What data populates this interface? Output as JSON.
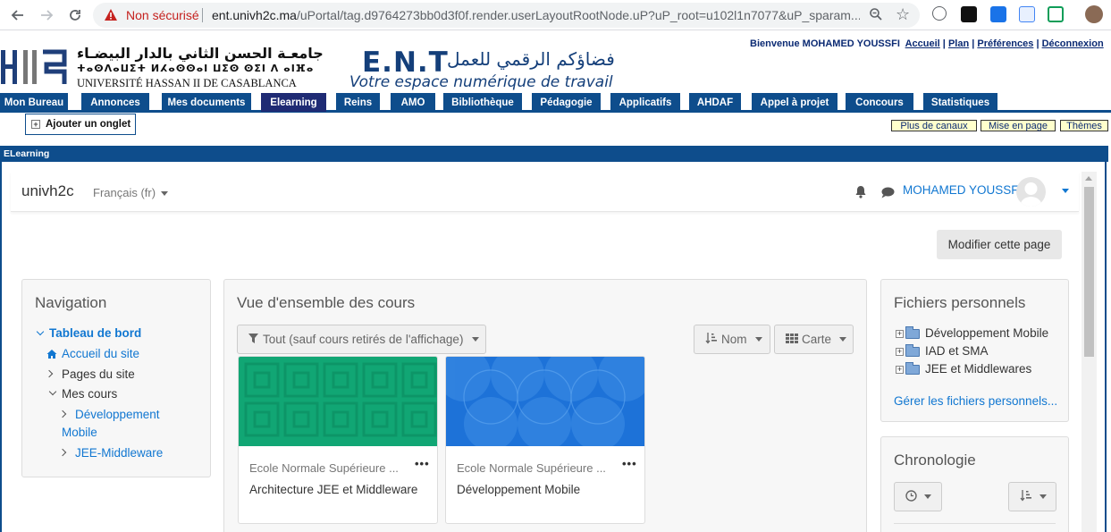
{
  "browser": {
    "security_label": "Non sécurisé",
    "url_host": "ent.univh2c.ma",
    "url_path": "/uPortal/tag.d9764273bb0d3f0f.render.userLayoutRootNode.uP?uP_root=u102l1n7077&uP_sparam..."
  },
  "header": {
    "university_ar": "جامعـة الحسن الثاني بالدار البيضـاء",
    "university_tf": "ⵜⴰⵙⴷⴰⵡⵉⵜ ⵍⵃⴰⵙⵙⴰⵏ ⵡⵉⵙ ⵙⵉⵏ ⴷ ⴰⵏⴼⴰ",
    "university_fr": "UNIVERSITÉ HASSAN II DE CASABLANCA",
    "ent_title": "E.N.T",
    "ent_arabic": "فضاؤكم الرقمي للعمل",
    "ent_subtitle": "Votre espace numérique de travail",
    "welcome": "Bienvenue MOHAMED YOUSSFI",
    "link_accueil": "Accueil",
    "link_plan": "Plan",
    "link_prefs": "Préférences",
    "link_logout": "Déconnexion"
  },
  "tabs": [
    "Mon Bureau",
    "Annonces",
    "Mes documents",
    "Elearning",
    "Reins",
    "AMO",
    "Bibliothèque",
    "Pédagogie",
    "Applicatifs",
    "AHDAF",
    "Appel à projet",
    "Concours",
    "Statistiques"
  ],
  "active_tab": "Elearning",
  "add_tab_label": "Ajouter un onglet",
  "channel_buttons": [
    "Plus de canaux",
    "Mise en page",
    "Thèmes"
  ],
  "portlet_title": "ELearning",
  "moodle": {
    "brand": "univh2c",
    "language": "Français ‎(fr)‎",
    "user": "MOHAMED YOUSSFI",
    "modify_page": "Modifier cette page",
    "navigation": {
      "title": "Navigation",
      "dashboard": "Tableau de bord",
      "home": "Accueil du site",
      "site_pages": "Pages du site",
      "my_courses": "Mes cours",
      "course1": "Développement Mobile",
      "course1_line1": "Développement",
      "course1_line2": "Mobile",
      "course2": "JEE-Middleware"
    },
    "overview": {
      "title": "Vue d'ensemble des cours",
      "filter": "Tout (sauf cours retirés de l'affichage)",
      "sort": "Nom",
      "view": "Carte",
      "cards": [
        {
          "category": "Ecole Normale Supérieure ...",
          "title": "Architecture JEE et Middleware"
        },
        {
          "category": "Ecole Normale Supérieure ...",
          "title": "Développement Mobile"
        }
      ]
    },
    "files": {
      "title": "Fichiers personnels",
      "items": [
        "Développement Mobile",
        "IAD et SMA",
        "JEE et Middlewares"
      ],
      "manage": "Gérer les fichiers personnels..."
    },
    "timeline": {
      "title": "Chronologie"
    }
  },
  "colors": {
    "ent_blue": "#0e4d8c",
    "active_tab": "#1f2b74",
    "link": "#1177d1",
    "card1": "#11a674",
    "card2": "#1d72d8"
  }
}
